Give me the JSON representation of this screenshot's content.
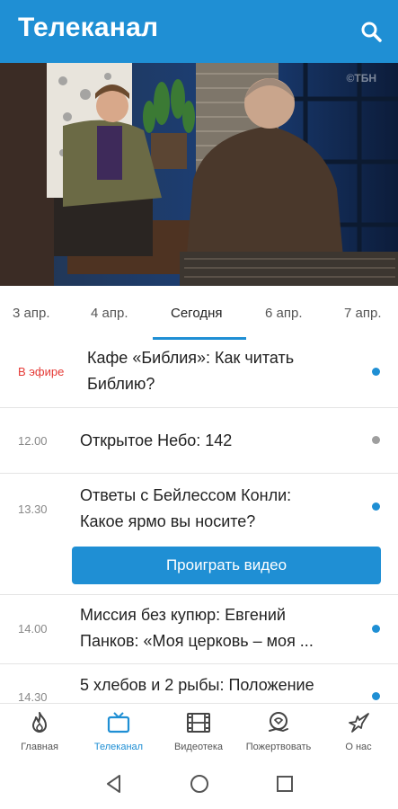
{
  "appbar": {
    "title": "Телеканал",
    "icon": "search-icon"
  },
  "hero": {
    "watermark": "©ТБН"
  },
  "dates": {
    "tabs": [
      "3 апр.",
      "4 апр.",
      "Сегодня",
      "6 апр.",
      "7 апр."
    ],
    "active": "Сегодня"
  },
  "schedule": [
    {
      "time": "В эфире",
      "title_line1": "Кафе «Библия»: Как читать",
      "title_line2": "Библию?",
      "dot_color": "#1f8fd4"
    },
    {
      "time": "12.00",
      "title_line1": "Открытое Небо: 142",
      "dot_color": "#9e9e9e"
    },
    {
      "time": "13.30",
      "title_line1": "Ответы с Бейлессом Конли:",
      "title_line2": "Какое ярмо вы носите?",
      "dot_color": "#1f8fd4",
      "button": "Проиграть видео"
    },
    {
      "time": "14.00",
      "title_line1": "Миссия без купюр: Евгений",
      "title_line2": "Панков: «Моя церковь – моя ...",
      "dot_color": "#1f8fd4"
    },
    {
      "time": "14.30",
      "title_line1": "5 хлебов и 2 рыбы: Положение",
      "dot_color": "#1f8fd4"
    }
  ],
  "bottom_nav": [
    {
      "label": "Главная",
      "icon": "flame-icon"
    },
    {
      "label": "Телеканал",
      "icon": "tv-icon",
      "active": true
    },
    {
      "label": "Видеотека",
      "icon": "film-icon"
    },
    {
      "label": "Пожертвовать",
      "icon": "donate-icon"
    },
    {
      "label": "О нас",
      "icon": "dove-icon"
    }
  ],
  "colors": {
    "accent": "#1f8fd4",
    "live": "#e53935"
  }
}
